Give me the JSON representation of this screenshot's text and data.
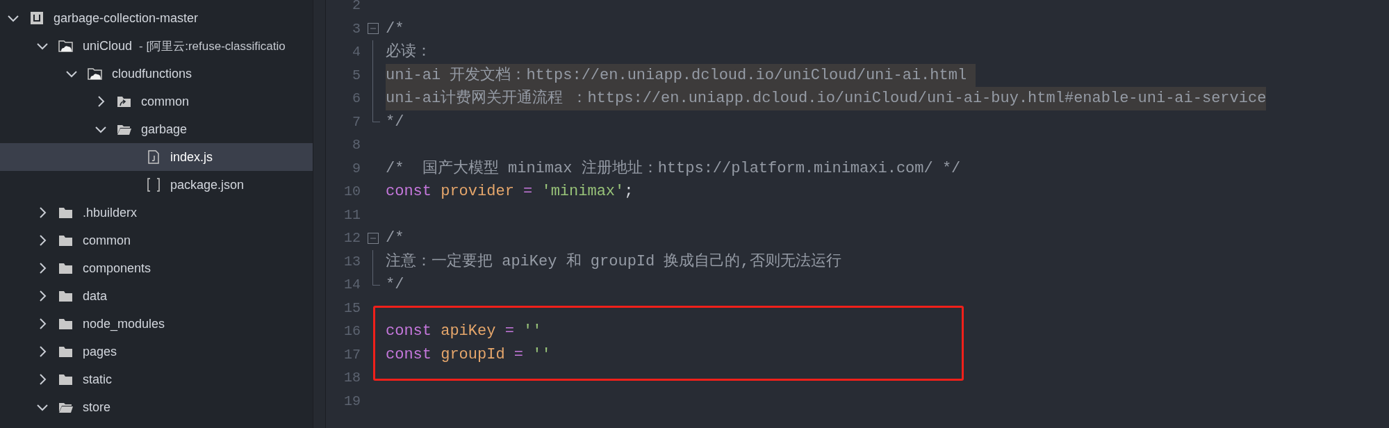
{
  "explorer": {
    "items": [
      {
        "label": "garbage-collection-master",
        "kind": "project",
        "expanded": true,
        "selected": false,
        "children": [
          {
            "label": "uniCloud",
            "suffix": "- [阿里云:refuse-classificatio",
            "kind": "cloud-folder",
            "expanded": true,
            "selected": false,
            "children": [
              {
                "label": "cloudfunctions",
                "kind": "cloud-folder",
                "expanded": true,
                "selected": false,
                "children": [
                  {
                    "label": "common",
                    "kind": "folder-link",
                    "expanded": false,
                    "selected": false
                  },
                  {
                    "label": "garbage",
                    "kind": "folder",
                    "expanded": true,
                    "selected": false,
                    "children": [
                      {
                        "label": "index.js",
                        "kind": "file-js",
                        "selected": true
                      },
                      {
                        "label": "package.json",
                        "kind": "file-json",
                        "selected": false
                      }
                    ]
                  }
                ]
              }
            ]
          },
          {
            "label": ".hbuilderx",
            "kind": "folder",
            "expanded": false,
            "selected": false
          },
          {
            "label": "common",
            "kind": "folder",
            "expanded": false,
            "selected": false
          },
          {
            "label": "components",
            "kind": "folder",
            "expanded": false,
            "selected": false
          },
          {
            "label": "data",
            "kind": "folder",
            "expanded": false,
            "selected": false
          },
          {
            "label": "node_modules",
            "kind": "folder",
            "expanded": false,
            "selected": false
          },
          {
            "label": "pages",
            "kind": "folder",
            "expanded": false,
            "selected": false
          },
          {
            "label": "static",
            "kind": "folder",
            "expanded": false,
            "selected": false
          },
          {
            "label": "store",
            "kind": "folder",
            "expanded": true,
            "selected": false
          }
        ]
      }
    ]
  },
  "editor": {
    "blocks": [
      {
        "boxed": false,
        "lines": [
          {
            "number": "2"
          },
          {
            "number": "3",
            "fold_toggle": true,
            "tokens": [
              {
                "kind": "comment",
                "text": "/*"
              }
            ]
          },
          {
            "number": "4",
            "in_fold": true,
            "tokens": [
              {
                "kind": "comment",
                "text": "必读："
              }
            ]
          },
          {
            "number": "5",
            "in_fold": true,
            "highlighted": true,
            "tokens": [
              {
                "kind": "comment",
                "text": "uni-ai 开发文档：https://en.uniapp.dcloud.io/uniCloud/uni-ai.html "
              }
            ]
          },
          {
            "number": "6",
            "in_fold": true,
            "highlighted": true,
            "tokens": [
              {
                "kind": "comment",
                "text": "uni-ai计费网关开通流程 ：https://en.uniapp.dcloud.io/uniCloud/uni-ai-buy.html#enable-uni-ai-service"
              }
            ]
          },
          {
            "number": "7",
            "fold_end": true,
            "tokens": [
              {
                "kind": "comment",
                "text": "*/"
              }
            ]
          },
          {
            "number": "8"
          },
          {
            "number": "9",
            "tokens": [
              {
                "kind": "comment",
                "text": "/*  国产大模型 minimax 注册地址：https://platform.minimaxi.com/ */"
              }
            ]
          },
          {
            "number": "10",
            "tokens": [
              {
                "kind": "keyword",
                "text": "const "
              },
              {
                "kind": "variable",
                "text": "provider "
              },
              {
                "kind": "operator",
                "text": "= "
              },
              {
                "kind": "string",
                "text": "'minimax'"
              },
              {
                "kind": "plain",
                "text": ";"
              }
            ]
          },
          {
            "number": "11"
          },
          {
            "number": "12",
            "fold_toggle": true,
            "tokens": [
              {
                "kind": "comment",
                "text": "/*"
              }
            ]
          },
          {
            "number": "13",
            "in_fold": true,
            "tokens": [
              {
                "kind": "comment",
                "text": "注意：一定要把 apiKey 和 groupId 换成自己的,否则无法运行"
              }
            ]
          },
          {
            "number": "14",
            "fold_end": true,
            "tokens": [
              {
                "kind": "comment",
                "text": "*/"
              }
            ]
          }
        ]
      },
      {
        "boxed": true,
        "lines": [
          {
            "number": "15"
          },
          {
            "number": "16",
            "tokens": [
              {
                "kind": "keyword",
                "text": "const "
              },
              {
                "kind": "variable",
                "text": "apiKey "
              },
              {
                "kind": "operator",
                "text": "= "
              },
              {
                "kind": "string",
                "text": "''"
              }
            ]
          },
          {
            "number": "17",
            "tokens": [
              {
                "kind": "keyword",
                "text": "const "
              },
              {
                "kind": "variable",
                "text": "groupId "
              },
              {
                "kind": "operator",
                "text": "= "
              },
              {
                "kind": "string",
                "text": "''"
              }
            ]
          },
          {
            "number": "18"
          }
        ]
      },
      {
        "boxed": false,
        "lines": [
          {
            "number": "19"
          }
        ]
      }
    ]
  }
}
